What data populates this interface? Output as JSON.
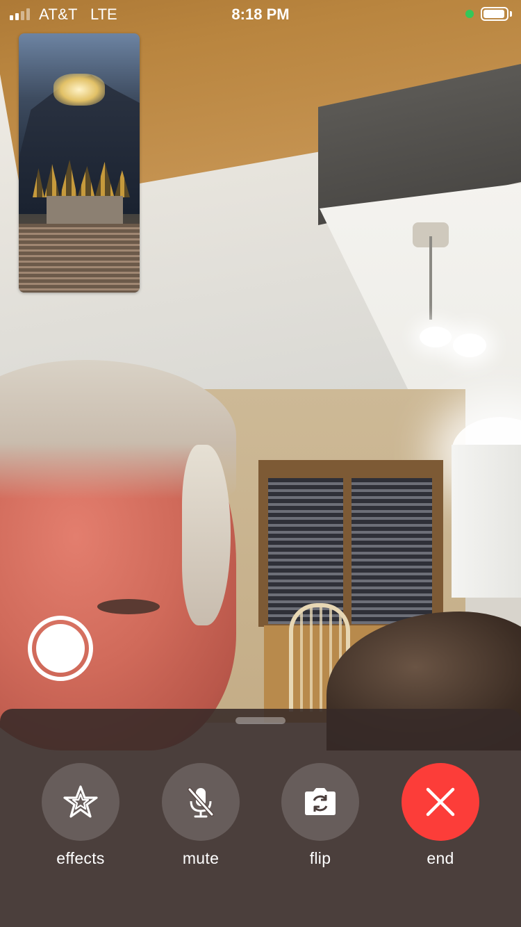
{
  "status_bar": {
    "carrier": "AT&T",
    "network": "LTE",
    "time": "8:18 PM",
    "signal_bars": 4,
    "signal_bars_filled": 2,
    "battery_level": 0.95,
    "mic_indicator_color": "#34c759"
  },
  "self_view": {
    "icon": "self-camera-preview"
  },
  "shutter": {
    "icon": "shutter-icon"
  },
  "controls": {
    "effects_label": "effects",
    "mute_label": "mute",
    "flip_label": "flip",
    "end_label": "end"
  },
  "colors": {
    "end_button": "#fc3d39",
    "control_button": "rgba(255,255,255,0.16)",
    "panel": "rgba(55,42,40,0.88)"
  }
}
